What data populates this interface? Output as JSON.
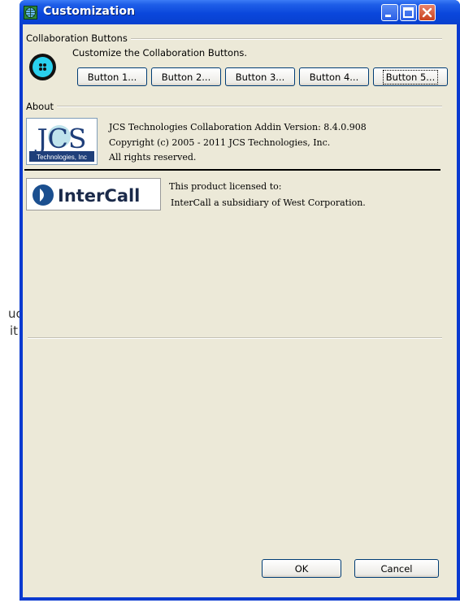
{
  "background": {
    "text_line1": "uc",
    "text_line2": "it"
  },
  "window": {
    "title": "Customization",
    "icon": "globe-icon"
  },
  "collaboration": {
    "group_label": "Collaboration Buttons",
    "description": "Customize the Collaboration Buttons.",
    "icon": "collaboration-icon",
    "buttons": [
      "Button 1...",
      "Button 2...",
      "Button 3...",
      "Button 4...",
      "Button 5..."
    ]
  },
  "about": {
    "group_label": "About",
    "logo_text": "JCS",
    "logo_subtext": "Technologies, Inc",
    "lines": [
      "JCS Technologies Collaboration Addin Version: 8.4.0.908",
      "Copyright (c) 2005 - 2011 JCS Technologies, Inc.",
      "All rights reserved."
    ]
  },
  "license": {
    "logo_text": "InterCall",
    "line1": "This product licensed to:",
    "line2": "InterCall a subsidiary of West Corporation."
  },
  "footer": {
    "ok_label": "OK",
    "cancel_label": "Cancel"
  },
  "colors": {
    "title_bar": "#0a47dc",
    "face": "#ece9d8",
    "collab_icon": "#2ad0ee"
  }
}
